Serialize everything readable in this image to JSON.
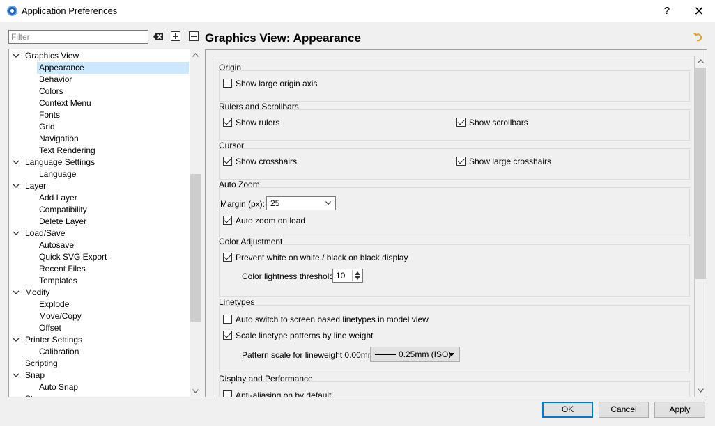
{
  "window": {
    "title": "Application Preferences",
    "help_label": "?",
    "close_label": "✕"
  },
  "filter": {
    "placeholder": "Filter",
    "value": ""
  },
  "icons": {
    "app": "app-icon",
    "clear": "clear-filter-icon",
    "expand_all": "expand-all-icon",
    "collapse_all": "collapse-all-icon",
    "reset": "undo-icon"
  },
  "tree": [
    {
      "label": "Graphics View",
      "level": 0,
      "expanded": true
    },
    {
      "label": "Appearance",
      "level": 1,
      "selected": true
    },
    {
      "label": "Behavior",
      "level": 1
    },
    {
      "label": "Colors",
      "level": 1
    },
    {
      "label": "Context Menu",
      "level": 1
    },
    {
      "label": "Fonts",
      "level": 1
    },
    {
      "label": "Grid",
      "level": 1
    },
    {
      "label": "Navigation",
      "level": 1
    },
    {
      "label": "Text Rendering",
      "level": 1
    },
    {
      "label": "Language Settings",
      "level": 0,
      "expanded": true
    },
    {
      "label": "Language",
      "level": 1
    },
    {
      "label": "Layer",
      "level": 0,
      "expanded": true
    },
    {
      "label": "Add Layer",
      "level": 1
    },
    {
      "label": "Compatibility",
      "level": 1
    },
    {
      "label": "Delete Layer",
      "level": 1
    },
    {
      "label": "Load/Save",
      "level": 0,
      "expanded": true
    },
    {
      "label": "Autosave",
      "level": 1
    },
    {
      "label": "Quick SVG Export",
      "level": 1
    },
    {
      "label": "Recent Files",
      "level": 1
    },
    {
      "label": "Templates",
      "level": 1
    },
    {
      "label": "Modify",
      "level": 0,
      "expanded": true
    },
    {
      "label": "Explode",
      "level": 1
    },
    {
      "label": "Move/Copy",
      "level": 1
    },
    {
      "label": "Offset",
      "level": 1
    },
    {
      "label": "Printer Settings",
      "level": 0,
      "expanded": true
    },
    {
      "label": "Calibration",
      "level": 1
    },
    {
      "label": "Scripting",
      "level": 0,
      "expanded": false
    },
    {
      "label": "Snap",
      "level": 0,
      "expanded": true
    },
    {
      "label": "Auto Snap",
      "level": 1
    },
    {
      "label": "St",
      "level": 0,
      "expanded": true
    }
  ],
  "panel": {
    "title": "Graphics View: Appearance"
  },
  "groups": {
    "origin": {
      "label": "Origin",
      "show_large_origin_axis": {
        "label": "Show large origin axis",
        "checked": false
      }
    },
    "rulers": {
      "label": "Rulers and Scrollbars",
      "show_rulers": {
        "label": "Show rulers",
        "checked": true
      },
      "show_scrollbars": {
        "label": "Show scrollbars",
        "checked": true
      }
    },
    "cursor": {
      "label": "Cursor",
      "show_crosshairs": {
        "label": "Show crosshairs",
        "checked": true
      },
      "show_large_crosshairs": {
        "label": "Show large crosshairs",
        "checked": true
      }
    },
    "auto_zoom": {
      "label": "Auto Zoom",
      "margin_label": "Margin (px):",
      "margin_value": "25",
      "auto_zoom_on_load": {
        "label": "Auto zoom on load",
        "checked": true
      }
    },
    "color_adjustment": {
      "label": "Color Adjustment",
      "prevent_white": {
        "label": "Prevent white on white / black on black display",
        "checked": true
      },
      "threshold_label": "Color lightness threshold:",
      "threshold_value": "10"
    },
    "linetypes": {
      "label": "Linetypes",
      "auto_switch": {
        "label": "Auto switch to screen based linetypes in model view",
        "checked": false
      },
      "scale_patterns": {
        "label": "Scale linetype patterns by line weight",
        "checked": true
      },
      "pattern_scale_label": "Pattern scale for lineweight 0.00mm:",
      "pattern_scale_value": "0.25mm (ISO)"
    },
    "display": {
      "label": "Display and Performance",
      "anti_aliasing": {
        "label": "Anti-aliasing on by default",
        "checked": false
      }
    }
  },
  "buttons": {
    "ok": "OK",
    "cancel": "Cancel",
    "apply": "Apply"
  }
}
